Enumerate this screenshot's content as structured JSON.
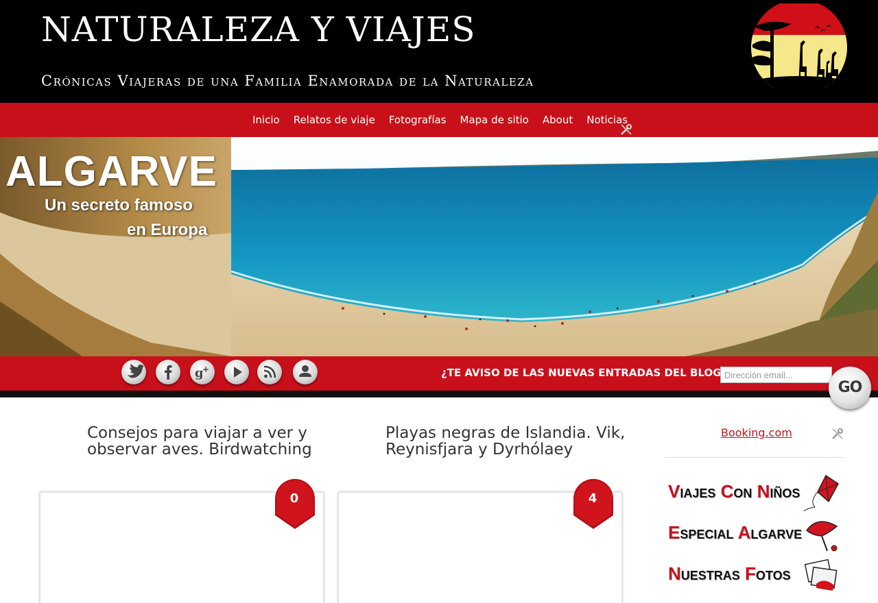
{
  "header": {
    "title": "NATURALEZA Y VIAJES",
    "subtitle": "Crónicas Viajeras de una Familia Enamorada de la Naturaleza",
    "logo_icon": "giraffe-sunset-logo"
  },
  "nav": {
    "items": [
      {
        "label": "Inicio"
      },
      {
        "label": "Relatos de viaje"
      },
      {
        "label": "Fotografías"
      },
      {
        "label": "Mapa de sitio"
      },
      {
        "label": "About"
      },
      {
        "label": "Noticias"
      }
    ]
  },
  "banner": {
    "title": "ALGARVE",
    "subtitle_line1": "Un secreto famoso",
    "subtitle_line2": "en Europa"
  },
  "social": {
    "icons": [
      "twitter-icon",
      "facebook-icon",
      "google-plus-icon",
      "youtube-icon",
      "rss-icon",
      "user-icon"
    ],
    "subscribe_label": "¿TE AVISO DE LAS NUEVAS ENTRADAS DEL BLOG?",
    "email_placeholder": "Dirección email...",
    "go_label": "GO"
  },
  "posts": [
    {
      "title": "Consejos para viajar a ver y observar aves. Birdwatching",
      "comments": "0"
    },
    {
      "title": "Playas negras de Islandia. Vik, Reynisfjara y Dyrhólaey",
      "comments": "4"
    }
  ],
  "sidebar": {
    "booking_label": "Booking.com",
    "promos": [
      {
        "first_cap": "V",
        "first_rest": "iajes ",
        "second_cap": "C",
        "second_rest": "on ",
        "third_cap": "N",
        "third_rest": "iños",
        "icon": "kite-icon"
      },
      {
        "first_cap": "E",
        "first_rest": "special ",
        "second_cap": "A",
        "second_rest": "lgarve",
        "third_cap": "",
        "third_rest": "",
        "icon": "umbrella-icon"
      },
      {
        "first_cap": "N",
        "first_rest": "uestras ",
        "second_cap": "F",
        "second_rest": "otos",
        "third_cap": "",
        "third_rest": "",
        "icon": "photos-icon"
      }
    ]
  },
  "colors": {
    "brand_red": "#c8101b",
    "header_black": "#000000",
    "text_dark": "#333333"
  }
}
